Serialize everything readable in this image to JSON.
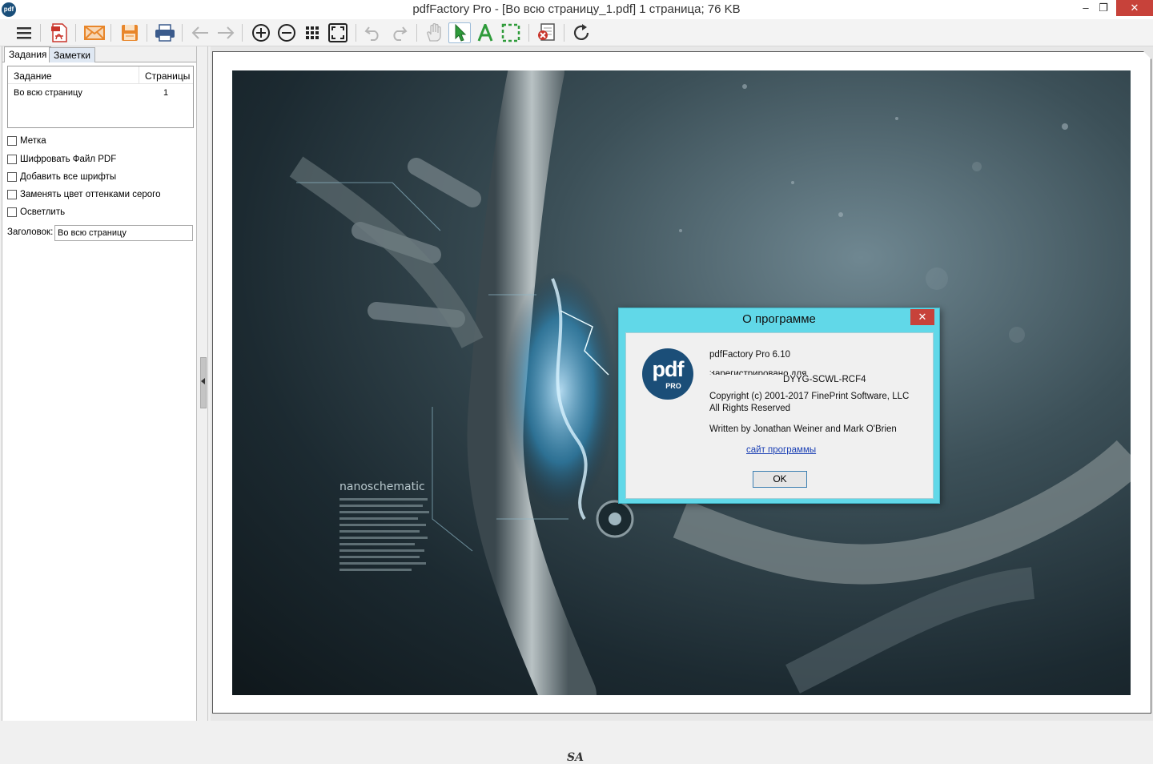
{
  "window": {
    "app_icon": "pdf",
    "title": "pdfFactory Pro - [Во всю страницу_1.pdf] 1 страница; 76 KB",
    "min": "–",
    "max": "❐",
    "close": "✕"
  },
  "toolbar": {
    "icons": [
      "menu-icon",
      "pdf-save-icon",
      "email-icon",
      "save-icon",
      "print-icon",
      "back-icon",
      "forward-icon",
      "zoom-in-icon",
      "zoom-out-icon",
      "thumbnails-icon",
      "fit-page-icon",
      "undo-icon",
      "redo-icon",
      "hand-icon",
      "select-arrow-icon",
      "text-tool-icon",
      "selection-tool-icon",
      "delete-page-icon",
      "refresh-icon"
    ],
    "active_tool": "select-arrow-icon",
    "colors": {
      "green_tool": "#2e9b3a",
      "orange_tool": "#e8862a",
      "red_tool": "#c9352b",
      "blue_tool": "#3b5b8c"
    }
  },
  "left_panel": {
    "tabs": [
      {
        "label": "Задания",
        "selected": true
      },
      {
        "label": "Заметки",
        "selected": false
      }
    ],
    "task_list": {
      "headers": [
        "Задание",
        "Страницы"
      ],
      "rows": [
        {
          "name": "Во всю страницу",
          "pages": "1"
        }
      ]
    },
    "options": [
      {
        "label": "Метка",
        "checked": false
      },
      {
        "label": "Шифровать Файл PDF",
        "checked": false
      },
      {
        "label": "Добавить все шрифты",
        "checked": false
      },
      {
        "label": "Заменять цвет оттенками серого",
        "checked": false
      },
      {
        "label": "Осветлить",
        "checked": false
      }
    ],
    "heading": {
      "label": "Заголовок:",
      "value": "Во всю страницу"
    }
  },
  "preview": {
    "photo_caption": "nanoschematic",
    "watermark": "SA"
  },
  "dialog": {
    "title": "О программе",
    "close": "✕",
    "logo_main": "pdf",
    "logo_sub": "PRO",
    "product": "pdfFactory Pro 6.10",
    "registered_partial": "Зарегистрировано для pdfFactory",
    "serial": "DYYG-SCWL-RCF4",
    "copyright": "Copyright (c) 2001-2017 FinePrint Software, LLC",
    "rights": "All Rights Reserved",
    "authors": "Written by Jonathan Weiner and Mark O'Brien",
    "link": "сайт программы",
    "ok": "OK",
    "accent_color": "#61d8e8"
  }
}
